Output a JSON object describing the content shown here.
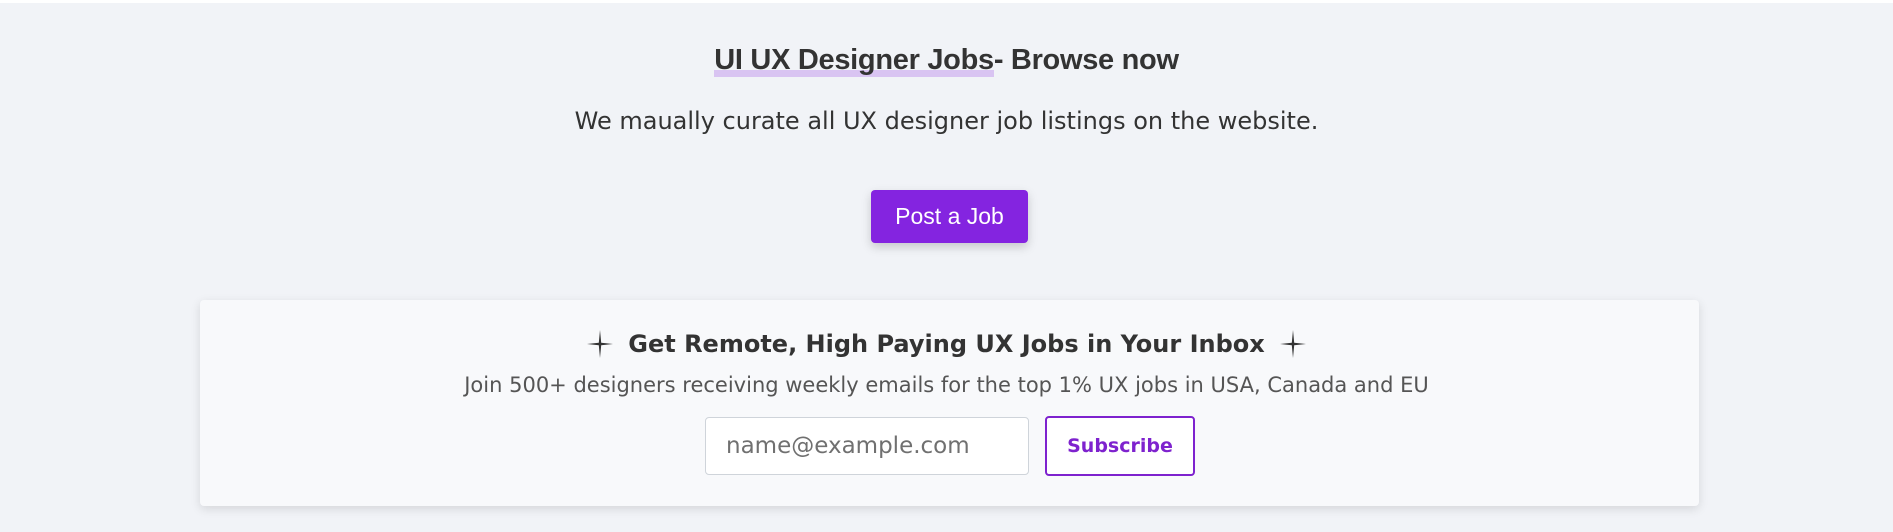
{
  "hero": {
    "title_highlight": "UI UX Designer Jobs",
    "title_rest": "- Browse now",
    "subtitle": "We maually curate all UX designer job listings on the website.",
    "post_button_label": "Post a Job"
  },
  "newsletter": {
    "title": "Get Remote, High Paying UX Jobs in Your Inbox",
    "left_icon": "sparkle-icon",
    "right_icon": "sparkle-icon",
    "subtitle": "Join 500+ designers receiving weekly emails for the top 1% UX jobs in USA, Canada and EU",
    "email_placeholder": "name@example.com",
    "subscribe_label": "Subscribe"
  },
  "colors": {
    "accent": "#8424e0",
    "background": "#f1f3f7",
    "card_background": "#f8f9fb",
    "highlight": "#d9c4f2"
  }
}
